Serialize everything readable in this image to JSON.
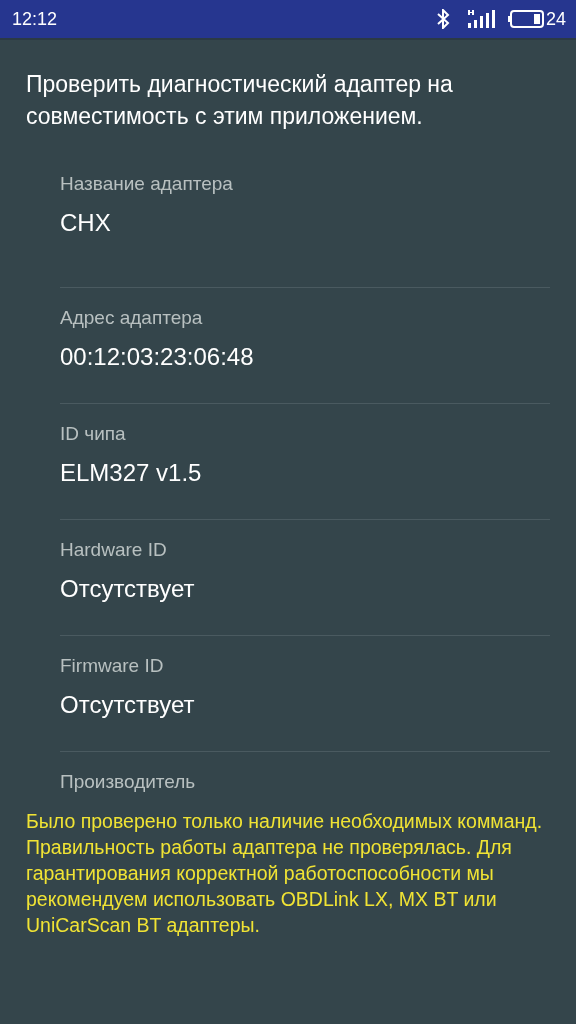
{
  "status_bar": {
    "time": "12:12",
    "battery_percent": "24"
  },
  "heading": "Проверить диагностический адаптер на совместимость с этим приложением.",
  "fields": [
    {
      "label": "Название адаптера",
      "value": "CHX"
    },
    {
      "label": "Адрес адаптера",
      "value": "00:12:03:23:06:48"
    },
    {
      "label": "ID чипа",
      "value": "ELM327 v1.5"
    },
    {
      "label": "Hardware ID",
      "value": "Отсутствует"
    },
    {
      "label": "Firmware ID",
      "value": "Отсутствует"
    },
    {
      "label": "Производитель"
    }
  ],
  "warning": "Было проверено только наличие необходимых комманд. Правильность работы адаптера не проверялась. Для гарантирования корректной работоспособности мы рекомендуем использовать OBDLink LX, MX BT или UniCarScan BT адаптеры."
}
